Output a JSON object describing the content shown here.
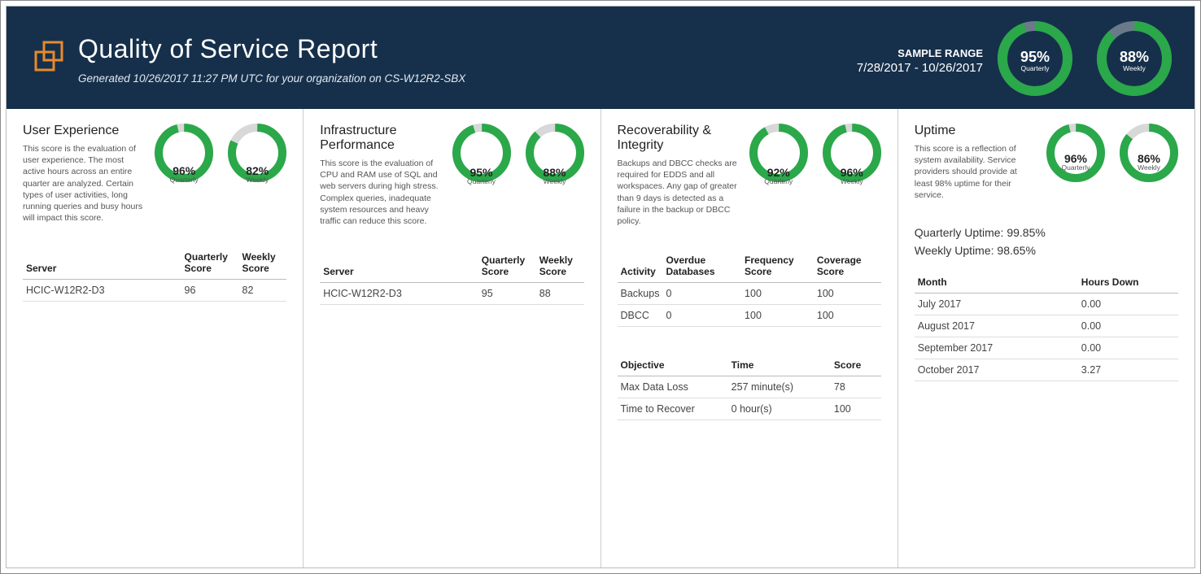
{
  "header": {
    "title": "Quality of Service Report",
    "subtitle": "Generated 10/26/2017 11:27 PM UTC for your organization on CS-W12R2-SBX",
    "sample_range_label": "SAMPLE RANGE",
    "sample_range_dates": "7/28/2017 - 10/26/2017",
    "gauge_quarterly": {
      "pct": "95%",
      "period": "Quarterly",
      "value": 95
    },
    "gauge_weekly": {
      "pct": "88%",
      "period": "Weekly",
      "value": 88
    }
  },
  "panels": {
    "ux": {
      "title": "User Experience",
      "desc": "This score is the evaluation of user experience. The most active hours across an entire quarter are analyzed. Certain types of user activities, long running queries and busy hours will impact this score.",
      "gauge_q": {
        "pct": "96%",
        "period": "Quarterly",
        "value": 96
      },
      "gauge_w": {
        "pct": "82%",
        "period": "Weekly",
        "value": 82
      },
      "table_headers": {
        "server": "Server",
        "q": "Quarterly Score",
        "w": "Weekly Score"
      },
      "rows": [
        {
          "server": "HCIC-W12R2-D3",
          "q": "96",
          "w": "82"
        }
      ]
    },
    "infra": {
      "title": "Infrastructure Performance",
      "desc": "This score is the evaluation of CPU and RAM use of SQL and web servers during high stress. Complex queries, inadequate system resources and heavy traffic can reduce this score.",
      "gauge_q": {
        "pct": "95%",
        "period": "Quarterly",
        "value": 95
      },
      "gauge_w": {
        "pct": "88%",
        "period": "Weekly",
        "value": 88
      },
      "table_headers": {
        "server": "Server",
        "q": "Quarterly Score",
        "w": "Weekly Score"
      },
      "rows": [
        {
          "server": "HCIC-W12R2-D3",
          "q": "95",
          "w": "88"
        }
      ]
    },
    "recovery": {
      "title": "Recoverability & Integrity",
      "desc": "Backups and DBCC checks are required for EDDS and all workspaces. Any gap of greater than 9 days is detected as a failure in the backup or DBCC policy.",
      "gauge_q": {
        "pct": "92%",
        "period": "Quarterly",
        "value": 92
      },
      "gauge_w": {
        "pct": "96%",
        "period": "Weekly",
        "value": 96
      },
      "table1_headers": {
        "activity": "Activity",
        "overdue": "Overdue Databases",
        "freq": "Frequency Score",
        "cov": "Coverage Score"
      },
      "table1_rows": [
        {
          "activity": "Backups",
          "overdue": "0",
          "freq": "100",
          "cov": "100"
        },
        {
          "activity": "DBCC",
          "overdue": "0",
          "freq": "100",
          "cov": "100"
        }
      ],
      "table2_headers": {
        "obj": "Objective",
        "time": "Time",
        "score": "Score"
      },
      "table2_rows": [
        {
          "obj": "Max Data Loss",
          "time": "257 minute(s)",
          "score": "78"
        },
        {
          "obj": "Time to Recover",
          "time": "0 hour(s)",
          "score": "100"
        }
      ]
    },
    "uptime": {
      "title": "Uptime",
      "desc": "This score is a reflection of system availability. Service providers should provide at least 98% uptime for their service.",
      "gauge_q": {
        "pct": "96%",
        "period": "Quarterly",
        "value": 96
      },
      "gauge_w": {
        "pct": "86%",
        "period": "Weekly",
        "value": 86
      },
      "quarterly_line": "Quarterly Uptime: 99.85%",
      "weekly_line": "Weekly Uptime: 98.65%",
      "table_headers": {
        "month": "Month",
        "hours": "Hours Down"
      },
      "rows": [
        {
          "month": "July 2017",
          "hours": "0.00"
        },
        {
          "month": "August 2017",
          "hours": "0.00"
        },
        {
          "month": "September 2017",
          "hours": "0.00"
        },
        {
          "month": "October 2017",
          "hours": "3.27"
        }
      ]
    }
  },
  "chart_data": [
    {
      "type": "donut",
      "label": "Header Quarterly",
      "value": 95,
      "max": 100,
      "period": "Quarterly"
    },
    {
      "type": "donut",
      "label": "Header Weekly",
      "value": 88,
      "max": 100,
      "period": "Weekly"
    },
    {
      "type": "donut",
      "label": "User Experience Quarterly",
      "value": 96,
      "max": 100,
      "period": "Quarterly"
    },
    {
      "type": "donut",
      "label": "User Experience Weekly",
      "value": 82,
      "max": 100,
      "period": "Weekly"
    },
    {
      "type": "donut",
      "label": "Infrastructure Quarterly",
      "value": 95,
      "max": 100,
      "period": "Quarterly"
    },
    {
      "type": "donut",
      "label": "Infrastructure Weekly",
      "value": 88,
      "max": 100,
      "period": "Weekly"
    },
    {
      "type": "donut",
      "label": "Recoverability Quarterly",
      "value": 92,
      "max": 100,
      "period": "Quarterly"
    },
    {
      "type": "donut",
      "label": "Recoverability Weekly",
      "value": 96,
      "max": 100,
      "period": "Weekly"
    },
    {
      "type": "donut",
      "label": "Uptime Quarterly",
      "value": 96,
      "max": 100,
      "period": "Quarterly"
    },
    {
      "type": "donut",
      "label": "Uptime Weekly",
      "value": 86,
      "max": 100,
      "period": "Weekly"
    }
  ]
}
